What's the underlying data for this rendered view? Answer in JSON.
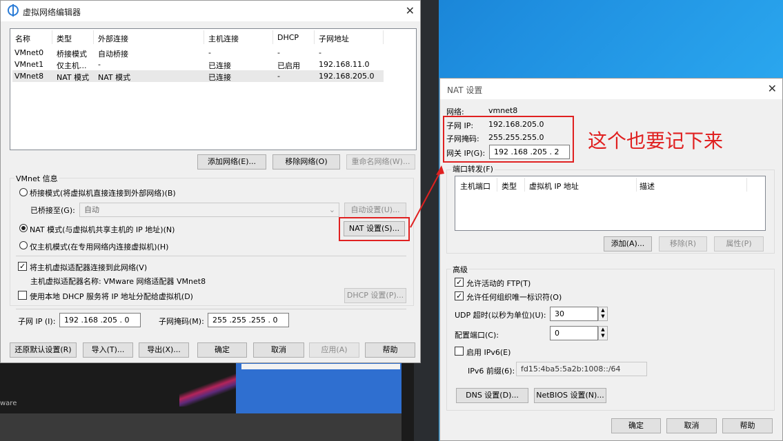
{
  "vne": {
    "title": "虚拟网络编辑器",
    "columns": [
      "名称",
      "类型",
      "外部连接",
      "主机连接",
      "DHCP",
      "子网地址"
    ],
    "rows": [
      [
        "VMnet0",
        "桥接模式",
        "自动桥接",
        "-",
        "-",
        "-"
      ],
      [
        "VMnet1",
        "仅主机...",
        "-",
        "已连接",
        "已启用",
        "192.168.11.0"
      ],
      [
        "VMnet8",
        "NAT 模式",
        "NAT 模式",
        "已连接",
        "-",
        "192.168.205.0"
      ]
    ],
    "add_network": "添加网络(E)...",
    "remove_network": "移除网络(O)",
    "rename_network": "重命名网络(W)...",
    "vmnet_info": "VMnet 信息",
    "bridge_mode": "桥接模式(将虚拟机直接连接到外部网络)(B)",
    "bridged_to_label": "已桥接至(G):",
    "bridged_to_value": "自动",
    "auto_settings": "自动设置(U)...",
    "nat_mode": "NAT 模式(与虚拟机共享主机的 IP 地址)(N)",
    "nat_settings": "NAT 设置(S)...",
    "host_only": "仅主机模式(在专用网络内连接虚拟机)(H)",
    "connect_adapter": "将主机虚拟适配器连接到此网络(V)",
    "adapter_name": "主机虚拟适配器名称: VMware 网络适配器 VMnet8",
    "use_dhcp": "使用本地 DHCP 服务将 IP 地址分配给虚拟机(D)",
    "dhcp_settings": "DHCP 设置(P)...",
    "subnet_ip_label": "子网 IP (I):",
    "subnet_ip": "192 .168 .205 .  0",
    "subnet_mask_label": "子网掩码(M):",
    "subnet_mask": "255 .255 .255 .  0",
    "restore_defaults": "还原默认设置(R)",
    "import": "导入(T)...",
    "export": "导出(X)...",
    "ok": "确定",
    "cancel": "取消",
    "apply": "应用(A)",
    "help": "帮助"
  },
  "nat": {
    "title": "NAT 设置",
    "network_label": "网络:",
    "network_value": "vmnet8",
    "subnet_ip_label": "子网 IP:",
    "subnet_ip_value": "192.168.205.0",
    "subnet_mask_label": "子网掩码:",
    "subnet_mask_value": "255.255.255.0",
    "gateway_label": "网关 IP(G):",
    "gateway_value": "192 .168 .205 .  2",
    "port_forwarding": "端口转发(F)",
    "pf_columns": [
      "主机端口",
      "类型",
      "虚拟机 IP 地址",
      "描述"
    ],
    "add": "添加(A)...",
    "remove": "移除(R)",
    "properties": "属性(P)",
    "advanced": "高级",
    "allow_ftp": "允许活动的 FTP(T)",
    "allow_oui": "允许任何组织唯一标识符(O)",
    "udp_timeout_label": "UDP 超时(以秒为单位)(U):",
    "udp_timeout_value": "30",
    "config_port_label": "配置端口(C):",
    "config_port_value": "0",
    "enable_ipv6": "启用 IPv6(E)",
    "ipv6_prefix_label": "IPv6 前缀(6):",
    "ipv6_prefix_value": "fd15:4ba5:5a2b:1008::/64",
    "dns_settings": "DNS 设置(D)...",
    "netbios_settings": "NetBIOS 设置(N)...",
    "ok": "确定",
    "cancel": "取消",
    "help": "帮助"
  },
  "annotation": {
    "text": "这个也要记下来",
    "color": "#e02020"
  },
  "background": {
    "caption": "ware"
  }
}
